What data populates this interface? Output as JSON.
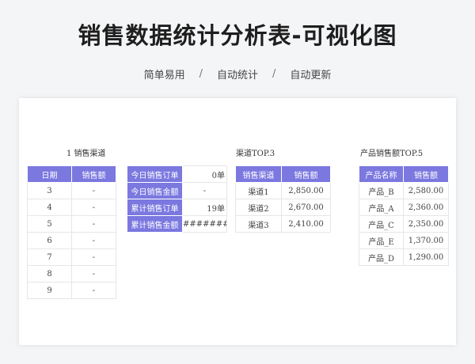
{
  "header": {
    "title": "销售数据统计分析表-可视化图",
    "subtitle_items": [
      "简单易用",
      "自动统计",
      "自动更新"
    ],
    "subtitle_sep": "/"
  },
  "date_section": {
    "label": "1 销售渠道",
    "columns": [
      "日期",
      "销售额"
    ],
    "rows": [
      [
        "3",
        "-"
      ],
      [
        "4",
        "-"
      ],
      [
        "5",
        "-"
      ],
      [
        "6",
        "-"
      ],
      [
        "7",
        "-"
      ],
      [
        "8",
        "-"
      ],
      [
        "9",
        "-"
      ]
    ]
  },
  "kpi": {
    "rows": [
      {
        "label": "今日销售订单",
        "value": "0单"
      },
      {
        "label": "今日销售金额",
        "value": "-"
      },
      {
        "label": "累计销售订单",
        "value": "19单"
      },
      {
        "label": "累计销售金额",
        "value": "##########"
      }
    ]
  },
  "channel_section": {
    "label": "渠道TOP.3",
    "columns": [
      "销售渠道",
      "销售额"
    ],
    "rows": [
      [
        "渠道1",
        "2,850.00"
      ],
      [
        "渠道2",
        "2,670.00"
      ],
      [
        "渠道3",
        "2,410.00"
      ]
    ]
  },
  "product_section": {
    "label": "产品销售额TOP.5",
    "columns": [
      "产品名称",
      "销售额"
    ],
    "rows": [
      [
        "产品_B",
        "2,580.00"
      ],
      [
        "产品_A",
        "2,360.00"
      ],
      [
        "产品_C",
        "2,350.00"
      ],
      [
        "产品_E",
        "1,370.00"
      ],
      [
        "产品_D",
        "1,290.00"
      ]
    ]
  },
  "colors": {
    "header_fill": "#7b78e0",
    "background": "#f4f5f7",
    "card": "#ffffff"
  }
}
